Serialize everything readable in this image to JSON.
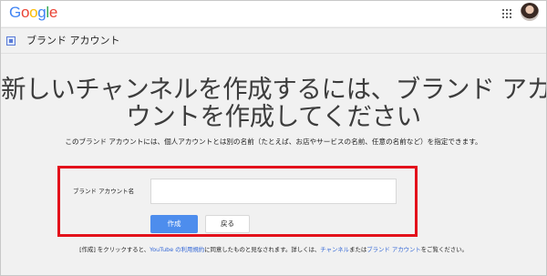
{
  "header": {
    "logo_letters": [
      {
        "char": "G",
        "color": "#4285F4"
      },
      {
        "char": "o",
        "color": "#EA4335"
      },
      {
        "char": "o",
        "color": "#FBBC05"
      },
      {
        "char": "g",
        "color": "#4285F4"
      },
      {
        "char": "l",
        "color": "#34A853"
      },
      {
        "char": "e",
        "color": "#EA4335"
      }
    ],
    "apps_icon": "apps-grid-icon",
    "avatar_icon": "profile-avatar"
  },
  "brand_bar": {
    "icon": "brand-account-icon",
    "title": "ブランド アカウント"
  },
  "main": {
    "heading_line1": "新しいチャンネルを作成するには、ブランド アカ",
    "heading_line2": "ウントを作成してください",
    "subtitle": "このブランド アカウントには、個人アカウントとは別の名前（たとえば、お店やサービスの名前、任意の名前など）を指定できます。"
  },
  "form": {
    "field_label": "ブランド アカウント名",
    "field_value": "",
    "field_placeholder": "",
    "create_label": "作成",
    "back_label": "戻る",
    "highlight_color": "#E3111B",
    "primary_color": "#4D8DED"
  },
  "footer": {
    "part1": "[作成] をクリックすると、",
    "link1": "YouTube の利用規約",
    "part2": "に同意したものと見なされます。詳しくは、",
    "link2": "チャンネル",
    "part3": "または",
    "link3": "ブランド アカウント",
    "part4": "をご覧ください。"
  }
}
